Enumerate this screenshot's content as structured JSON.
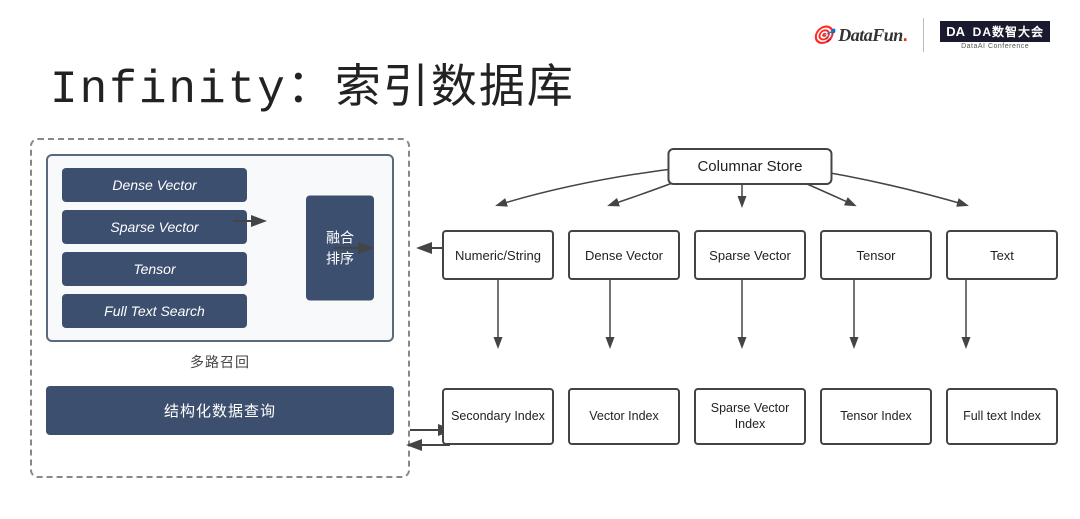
{
  "page": {
    "background": "#ffffff"
  },
  "logo": {
    "datafun": "DataFun.",
    "datafun_icon": "🎯",
    "da_label": "DA数智大会",
    "da_sub": "DataAI Conference"
  },
  "title": {
    "text": "Infinity：索引数据库"
  },
  "left_diagram": {
    "recall_items": [
      "Dense Vector",
      "Sparse Vector",
      "Tensor",
      "Full Text Search"
    ],
    "merge_label": "融合\n排序",
    "recall_label": "多路召回",
    "query_label": "结构化数据查询"
  },
  "right_diagram": {
    "columnar_store": "Columnar Store",
    "col_types": [
      "Numeric/String",
      "Dense Vector",
      "Sparse Vector",
      "Tensor",
      "Text"
    ],
    "indexes": [
      "Secondary Index",
      "Vector Index",
      "Sparse Vector Index",
      "Tensor Index",
      "Full text Index"
    ]
  }
}
